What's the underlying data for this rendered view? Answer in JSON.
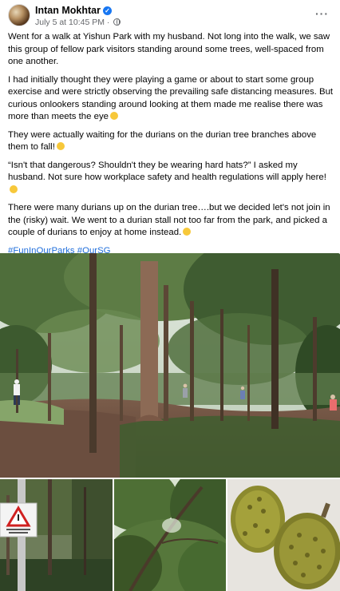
{
  "post": {
    "author": "Intan Mokhtar",
    "timestamp": "July 5 at 10:45 PM",
    "paragraphs": [
      "Went for a walk at Yishun Park with my husband. Not long into the walk, we saw this group of fellow park visitors standing around some trees, well-spaced from one another.",
      "I had initially thought they were playing a game or about to start some group exercise and were strictly observing the prevailing safe distancing measures. But curious onlookers standing around looking at them made me realise there was more than meets the eye",
      "They were actually waiting for the durians on the durian tree branches above them to fall!",
      "“Isn't that dangerous? Shouldn't they be wearing hard hats?” I asked my husband. Not sure how workplace safety and health regulations will apply here!",
      "There were many durians up on the durian tree….but we decided let's not join in the (risky) wait. We went to a durian stall not too far from the park, and picked a couple of durians to enjoy at home instead."
    ],
    "hashtags": [
      "#FunInOurParks",
      "#OurSG"
    ]
  },
  "icons": {
    "avatar": "profile-photo",
    "verified": "verified-badge-icon",
    "audience": "globe-icon",
    "more": "more-options-icon"
  },
  "colors": {
    "link": "#216fdb",
    "verified": "#1877f2",
    "meta_text": "#65676b"
  },
  "images": [
    {
      "name": "park-trees-photo"
    },
    {
      "name": "warning-sign-photo"
    },
    {
      "name": "durian-tree-canopy-photo"
    },
    {
      "name": "durians-photo"
    }
  ]
}
